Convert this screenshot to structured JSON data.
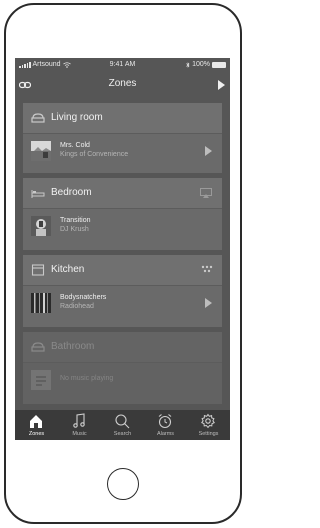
{
  "statusbar": {
    "carrier": "Artsound",
    "time": "9:41 AM",
    "battery": "100%"
  },
  "navbar": {
    "title": "Zones",
    "link_icon": "link-icon",
    "play_icon": "play-icon"
  },
  "zones": [
    {
      "name": "Living room",
      "icon": "couch-icon",
      "track": "Mrs. Cold",
      "artist": "Kings of Convenience",
      "action": "play-icon"
    },
    {
      "name": "Bedroom",
      "icon": "bed-icon",
      "track": "Transition",
      "artist": "DJ Krush",
      "action": "airplay-icon"
    },
    {
      "name": "Kitchen",
      "icon": "kitchen-icon",
      "track": "Bodysnatchers",
      "artist": "Radiohead",
      "action": "play-icon"
    },
    {
      "name": "Bathroom",
      "icon": "bathroom-icon",
      "track": "No music playing",
      "artist": "",
      "action": ""
    }
  ],
  "tabs": [
    {
      "label": "Zones",
      "icon": "home-icon",
      "active": true
    },
    {
      "label": "Music",
      "icon": "music-note-icon"
    },
    {
      "label": "Search",
      "icon": "search-icon"
    },
    {
      "label": "Alarms",
      "icon": "alarm-clock-icon"
    },
    {
      "label": "Settings",
      "icon": "gear-icon"
    }
  ]
}
